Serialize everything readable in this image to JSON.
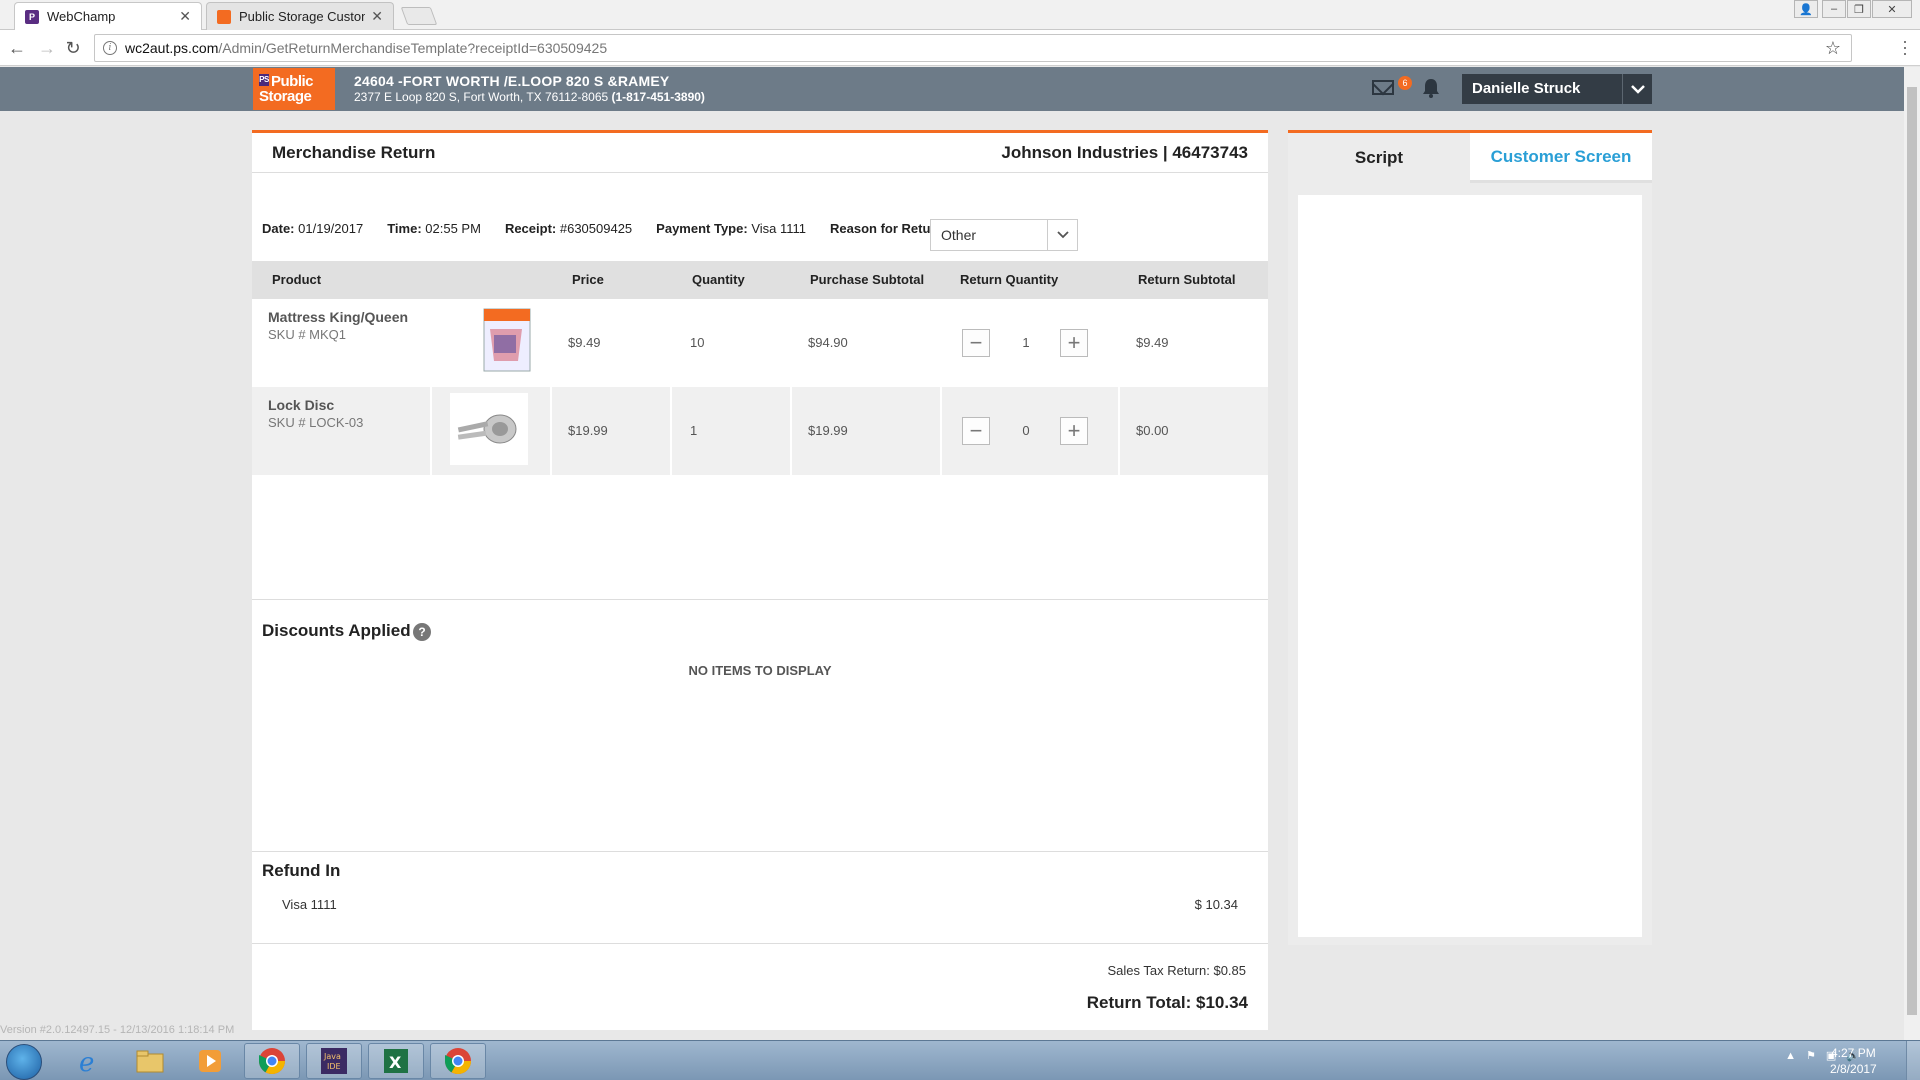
{
  "browser": {
    "tabs": [
      {
        "title": "WebChamp",
        "active": true,
        "favicon_color": "#5a2d82"
      },
      {
        "title": "Public Storage Customer",
        "active": false,
        "favicon_color": "#f36b21"
      }
    ],
    "url_host": "wc2aut.ps.com",
    "url_path": "/Admin/GetReturnMerchandiseTemplate?receiptId=630509425"
  },
  "header": {
    "logo_text_1": "Public",
    "logo_text_2": "Storage",
    "store_name": "24604 -FORT WORTH /E.LOOP 820 S &RAMEY",
    "store_address": "2377 E Loop 820 S, Fort Worth, TX 76112-8065",
    "store_phone": "(1-817-451-3890)",
    "mail_count": "6",
    "user_name": "Danielle Struck"
  },
  "main": {
    "title": "Merchandise Return",
    "customer": "Johnson Industries | 46473743",
    "meta": {
      "date_label": "Date:",
      "date": "01/19/2017",
      "time_label": "Time:",
      "time": "02:55 PM",
      "receipt_label": "Receipt:",
      "receipt": "#630509425",
      "payment_label": "Payment Type:",
      "payment": "Visa 1111",
      "reason_label": "Reason for Return:",
      "reason": "Other"
    },
    "columns": [
      "Product",
      "Price",
      "Quantity",
      "Purchase Subtotal",
      "Return Quantity",
      "Return Subtotal"
    ],
    "rows": [
      {
        "name": "Mattress King/Queen",
        "sku": "SKU # MKQ1",
        "price": "$9.49",
        "quantity": "10",
        "purchase_subtotal": "$94.90",
        "return_quantity": "1",
        "return_subtotal": "$9.49"
      },
      {
        "name": "Lock Disc",
        "sku": "SKU # LOCK-03",
        "price": "$19.99",
        "quantity": "1",
        "purchase_subtotal": "$19.99",
        "return_quantity": "0",
        "return_subtotal": "$0.00"
      }
    ],
    "discounts_title": "Discounts Applied",
    "discounts_empty": "NO ITEMS TO DISPLAY",
    "refund_title": "Refund In",
    "refund_method": "Visa 1111",
    "refund_amount": "$ 10.34",
    "sales_tax": "Sales Tax Return: $0.85",
    "return_total": "Return Total: $10.34"
  },
  "right_panel": {
    "tab_script": "Script",
    "tab_customer": "Customer Screen"
  },
  "footer": {
    "version": "Version #2.0.12497.15 - 12/13/2016 1:18:14 PM"
  },
  "taskbar": {
    "time": "4:27 PM",
    "date": "2/8/2017"
  },
  "colors": {
    "accent": "#f36b21",
    "header_bg": "#6d7b88",
    "link": "#2a9fd6"
  }
}
